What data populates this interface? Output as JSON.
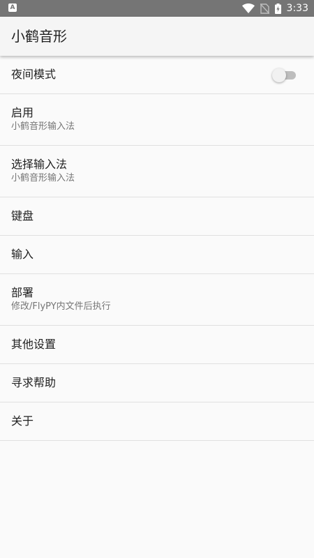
{
  "status_bar": {
    "left_icon_label": "A",
    "time": "3:33",
    "icons": [
      "wifi-icon",
      "no-sim-icon",
      "battery-charging-icon"
    ]
  },
  "app_bar": {
    "title": "小鹤音形"
  },
  "settings": {
    "night_mode": {
      "title": "夜间模式",
      "enabled": false
    },
    "enable": {
      "title": "启用",
      "summary": "小鹤音形输入法"
    },
    "select_ime": {
      "title": "选择输入法",
      "summary": "小鹤音形输入法"
    },
    "keyboard": {
      "title": "键盘"
    },
    "input": {
      "title": "输入"
    },
    "deploy": {
      "title": "部署",
      "summary": "修改/FlyPY内文件后执行"
    },
    "other_settings": {
      "title": "其他设置"
    },
    "help": {
      "title": "寻求帮助"
    },
    "about": {
      "title": "关于"
    }
  },
  "colors": {
    "status_bar": "#757575",
    "app_bar": "#f5f5f5",
    "background": "#fafafa",
    "divider": "#e0e0e0",
    "switch_track_off": "#bdbdbd"
  }
}
